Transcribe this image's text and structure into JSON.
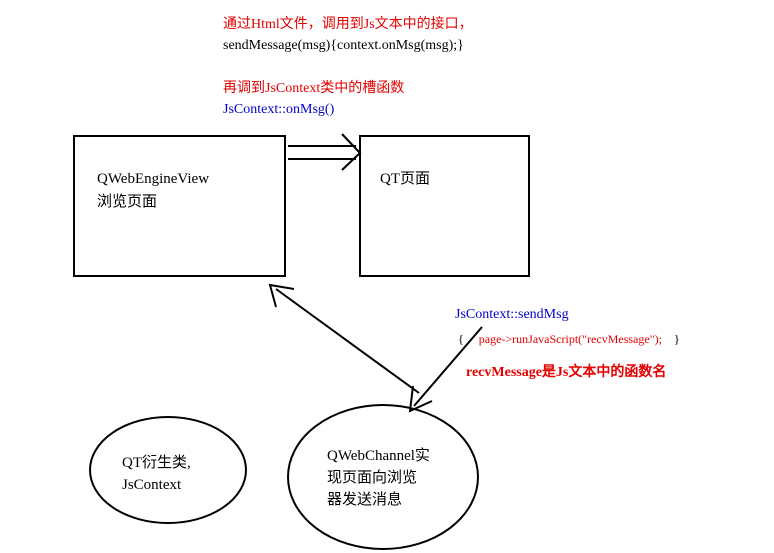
{
  "topNote": {
    "line1": "通过Html文件，调用到Js文本中的接口，",
    "line2": "sendMessage(msg){context.onMsg(msg);}"
  },
  "midNote": {
    "line1": "再调到JsContext类中的槽函数",
    "line2": "JsContext::onMsg()"
  },
  "boxLeft": {
    "line1": "QWebEngineView",
    "line2": "浏览页面"
  },
  "boxRight": {
    "line1": "QT页面"
  },
  "rightNote": {
    "line1": "JsContext::sendMsg",
    "braceOpen": "{",
    "code": "page->runJavaScript(\"recvMessage\");",
    "braceClose": "}",
    "line3": "recvMessage是Js文本中的函数名"
  },
  "ellipseLeft": {
    "line1": "QT衍生类,",
    "line2": "JsContext"
  },
  "ellipseRight": {
    "line1": "QWebChannel实",
    "line2": "现页面向浏览",
    "line3": "器发送消息"
  }
}
